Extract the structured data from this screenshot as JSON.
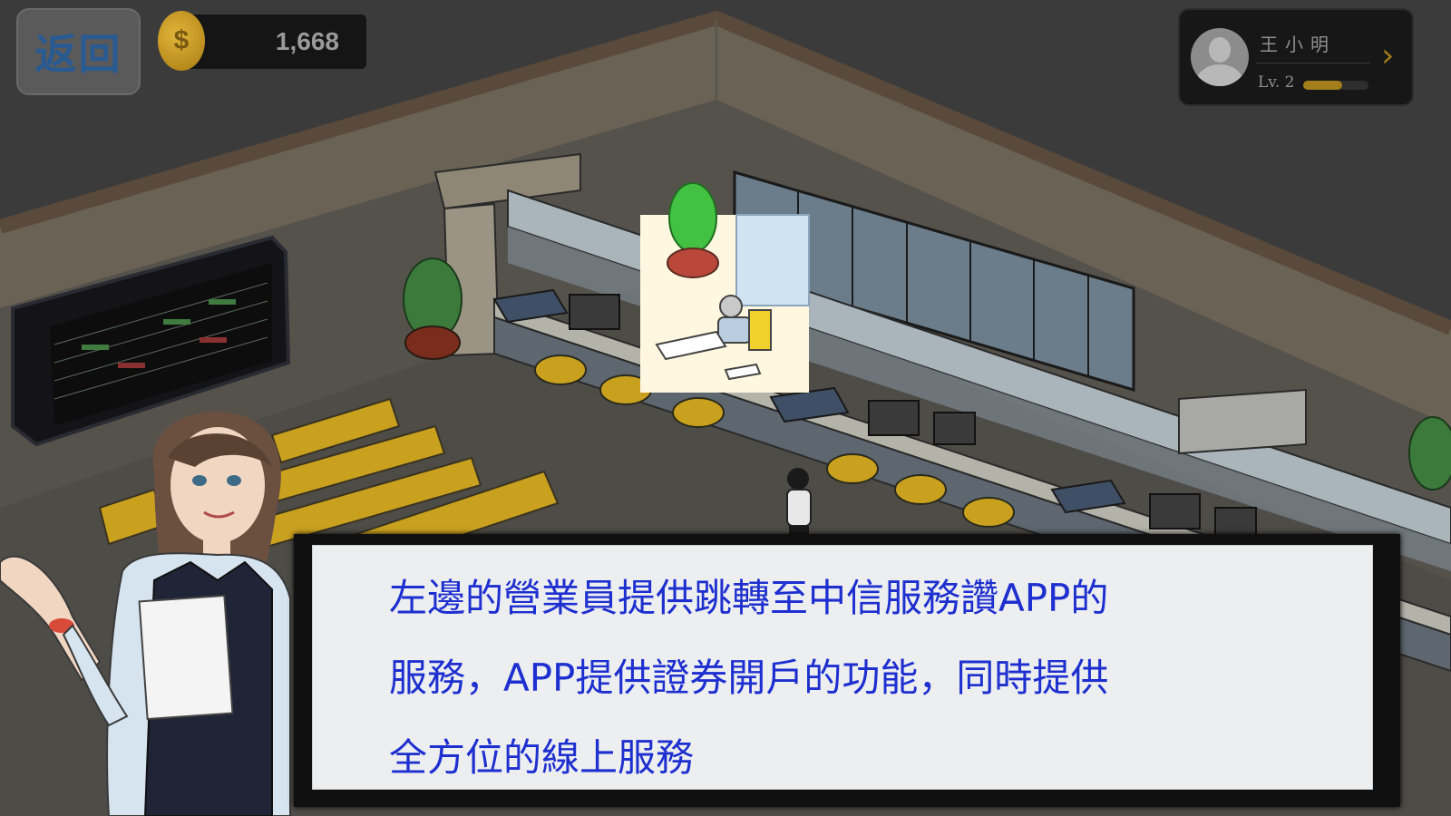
{
  "header": {
    "back_label": "返回",
    "coin_symbol": "$",
    "coins": "1,668"
  },
  "profile": {
    "name": "王小明",
    "level": "Lv. 2",
    "xp_fraction": 0.6
  },
  "dialog": {
    "lines": [
      "左邊的營業員提供跳轉至中信服務讚APP的",
      "服務，APP提供證券開戶的功能，同時提供",
      "全方位的線上服務"
    ]
  },
  "colors": {
    "dialog_text": "#1e2fd0",
    "back_text": "#2a5a92",
    "coin": "#d6a730",
    "highlight": "#fff7e0"
  }
}
